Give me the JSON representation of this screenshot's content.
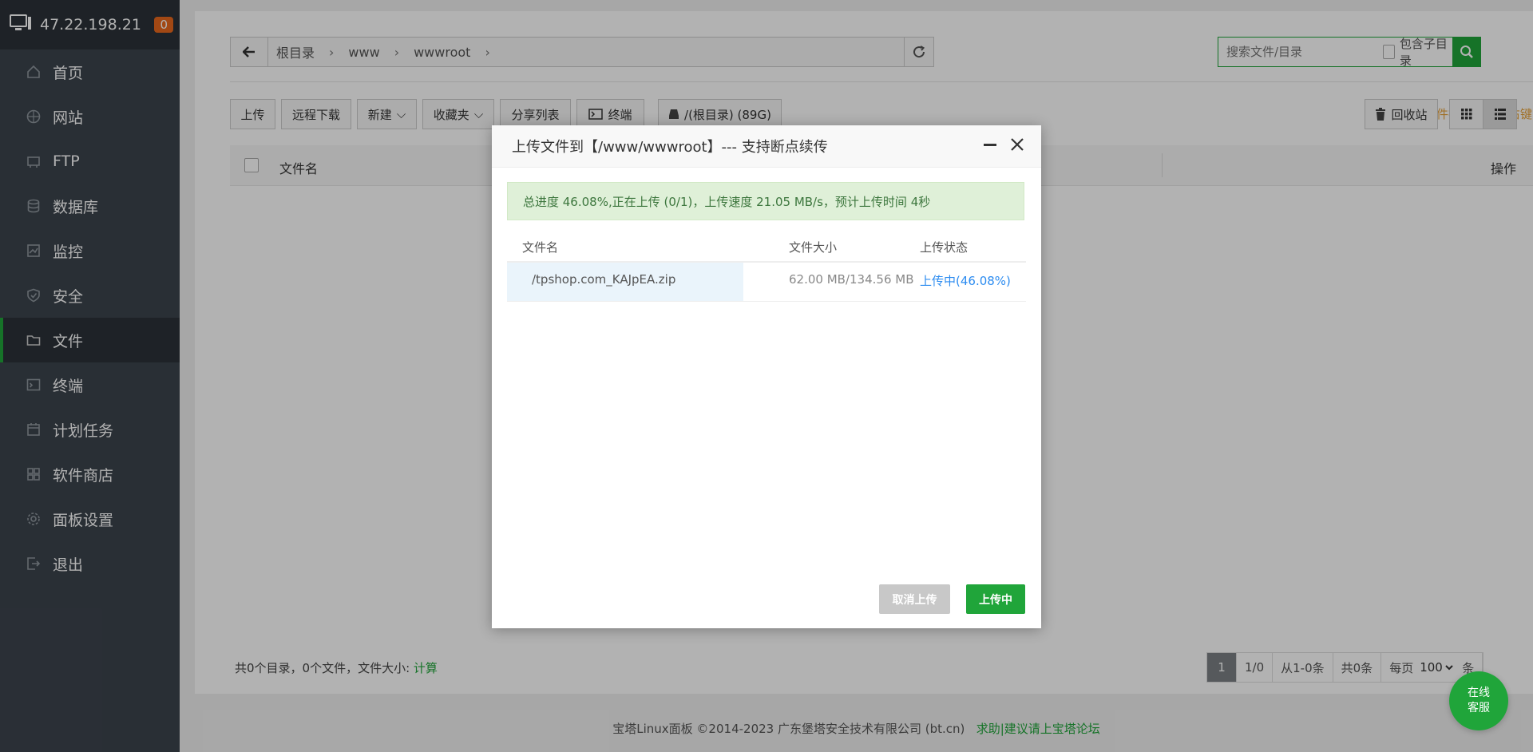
{
  "sidebar": {
    "server_ip": "47.22.198.21",
    "alert_count": "0",
    "items": [
      {
        "label": "首页",
        "icon": "home-icon"
      },
      {
        "label": "网站",
        "icon": "globe-icon"
      },
      {
        "label": "FTP",
        "icon": "ftp-icon"
      },
      {
        "label": "数据库",
        "icon": "database-icon"
      },
      {
        "label": "监控",
        "icon": "monitor-icon"
      },
      {
        "label": "安全",
        "icon": "shield-icon"
      },
      {
        "label": "文件",
        "icon": "folder-icon"
      },
      {
        "label": "终端",
        "icon": "terminal-icon"
      },
      {
        "label": "计划任务",
        "icon": "calendar-icon"
      },
      {
        "label": "软件商店",
        "icon": "apps-icon"
      },
      {
        "label": "面板设置",
        "icon": "gear-icon"
      },
      {
        "label": "退出",
        "icon": "logout-icon"
      }
    ],
    "active": "文件"
  },
  "breadcrumb": {
    "items": [
      "根目录",
      "www",
      "wwwroot"
    ]
  },
  "search": {
    "placeholder": "搜索文件/目录",
    "include_sub": "包含子目录"
  },
  "toolbar": {
    "upload": "上传",
    "remote_download": "远程下载",
    "new": "新建",
    "favorites": "收藏夹",
    "share_list": "分享列表",
    "terminal": "终端",
    "disk": "/(根目录) (89G)",
    "tip": "文件操作可使用右键",
    "recycle": "回收站"
  },
  "table": {
    "col_name": "文件名",
    "col_action": "操作"
  },
  "footer": {
    "summary": "共0个目录，0个文件，文件大小: ",
    "calc": "计算",
    "pager": {
      "current": "1",
      "pages": "1/0",
      "range": "从1-0条",
      "total": "共0条",
      "per_page_label": "每页",
      "per_page": "100",
      "unit": "条"
    }
  },
  "copyright": {
    "text": "宝塔Linux面板 ©2014-2023 广东堡塔安全技术有限公司 (bt.cn)",
    "link": "求助|建议请上宝塔论坛"
  },
  "service": {
    "label": "在线\n客服"
  },
  "modal": {
    "title": "上传文件到【/www/wwwroot】--- 支持断点续传",
    "progress": "总进度 46.08%,正在上传 (0/1)，上传速度 21.05 MB/s，预计上传时间 4秒",
    "headers": {
      "name": "文件名",
      "size": "文件大小",
      "status": "上传状态"
    },
    "files": [
      {
        "name": "/tpshop.com_KAJpEA.zip",
        "size": "62.00 MB/134.56 MB",
        "status": "上传中(46.08%)"
      }
    ],
    "cancel": "取消上传",
    "uploading": "上传中"
  },
  "colors": {
    "accent": "#20a53a",
    "sidebar_bg": "#3c444d",
    "warning": "#e6a23c",
    "link_blue": "#2d8cf0",
    "badge": "#e8681d"
  }
}
